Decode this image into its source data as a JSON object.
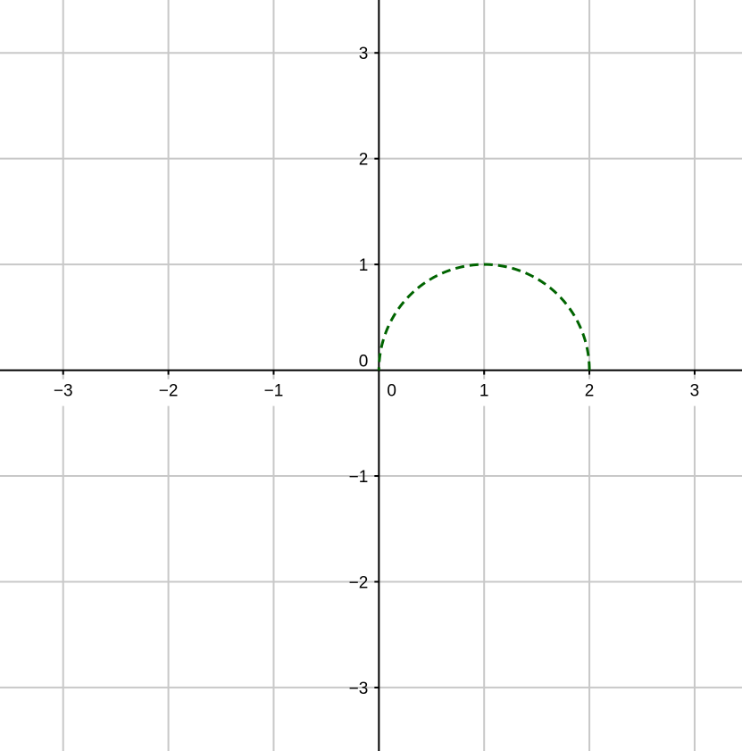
{
  "chart_data": {
    "type": "line",
    "title": "",
    "xlabel": "",
    "ylabel": "",
    "xlim": [
      -3.6,
      3.45
    ],
    "ylim": [
      -3.6,
      3.5
    ],
    "grid": true,
    "grid_color": "#c8c8c8",
    "axis_color": "#000000",
    "x_ticks": [
      -3,
      -2,
      -1,
      0,
      1,
      2,
      3
    ],
    "y_ticks": [
      -3,
      -2,
      -1,
      0,
      1,
      2,
      3
    ],
    "x_tick_labels": [
      "−3",
      "−2",
      "−1",
      "0",
      "1",
      "2",
      "3"
    ],
    "y_tick_labels": [
      "−3",
      "−2",
      "−1",
      "0",
      "1",
      "2",
      "3"
    ],
    "series": [
      {
        "kind": "semicircle",
        "center": [
          1,
          0
        ],
        "radius": 1,
        "from_angle_deg": 0,
        "to_angle_deg": 180,
        "color": "#006400",
        "style": "dashed"
      }
    ]
  }
}
